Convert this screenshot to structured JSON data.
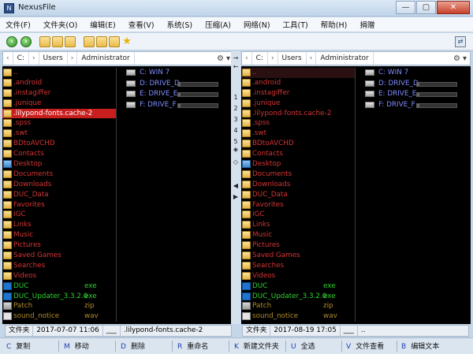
{
  "window": {
    "title": "NexusFile",
    "controls": [
      "—",
      "▢",
      "✕"
    ]
  },
  "menu": [
    "文件(F)",
    "文件夹(O)",
    "编辑(E)",
    "查看(V)",
    "系统(S)",
    "压缩(A)",
    "网络(N)",
    "工具(T)",
    "帮助(H)",
    "捐赠"
  ],
  "left": {
    "path": [
      "C:",
      "Users",
      "Administrator"
    ],
    "files": [
      {
        "name": "..",
        "type": "folder",
        "color": "#d43434",
        "ext": ""
      },
      {
        "name": ".android",
        "type": "folder",
        "color": "#d43434",
        "ext": ""
      },
      {
        "name": ".instagiffer",
        "type": "folder",
        "color": "#d43434",
        "ext": ""
      },
      {
        "name": ".junique",
        "type": "folder",
        "color": "#d43434",
        "ext": ""
      },
      {
        "name": ".lilypond-fonts.cache-2",
        "type": "folder",
        "color": "#ffffff",
        "ext": "",
        "selected": true
      },
      {
        "name": ".spss",
        "type": "folder",
        "color": "#d43434",
        "ext": ""
      },
      {
        "name": ".swt",
        "type": "folder",
        "color": "#d43434",
        "ext": ""
      },
      {
        "name": "BDtoAVCHD",
        "type": "folder",
        "color": "#d43434",
        "ext": ""
      },
      {
        "name": "Contacts",
        "type": "folder",
        "color": "#d43434",
        "ext": ""
      },
      {
        "name": "Desktop",
        "type": "folder-blue",
        "color": "#d43434",
        "ext": ""
      },
      {
        "name": "Documents",
        "type": "folder",
        "color": "#d43434",
        "ext": ""
      },
      {
        "name": "Downloads",
        "type": "folder",
        "color": "#d43434",
        "ext": ""
      },
      {
        "name": "DUC_Data",
        "type": "folder",
        "color": "#d43434",
        "ext": ""
      },
      {
        "name": "Favorites",
        "type": "folder",
        "color": "#d43434",
        "ext": ""
      },
      {
        "name": "IGC",
        "type": "folder",
        "color": "#d43434",
        "ext": ""
      },
      {
        "name": "Links",
        "type": "folder",
        "color": "#d43434",
        "ext": ""
      },
      {
        "name": "Music",
        "type": "folder",
        "color": "#d43434",
        "ext": ""
      },
      {
        "name": "Pictures",
        "type": "folder",
        "color": "#d43434",
        "ext": ""
      },
      {
        "name": "Saved Games",
        "type": "folder",
        "color": "#d43434",
        "ext": ""
      },
      {
        "name": "Searches",
        "type": "folder",
        "color": "#d43434",
        "ext": ""
      },
      {
        "name": "Videos",
        "type": "folder",
        "color": "#d43434",
        "ext": ""
      },
      {
        "name": "DUC",
        "type": "exe",
        "color": "#2fd12f",
        "ext": "exe"
      },
      {
        "name": "DUC_Updater_3.3.2.0",
        "type": "exe",
        "color": "#2fd12f",
        "ext": "exe"
      },
      {
        "name": "Patch",
        "type": "zip",
        "color": "#b08b2a",
        "ext": "zip"
      },
      {
        "name": "sound_notice",
        "type": "wav",
        "color": "#b08b2a",
        "ext": "wav"
      }
    ],
    "drives": [
      {
        "label": "C: WIN 7",
        "fill": 0
      },
      {
        "label": "D: DRIVE_D",
        "fill": 0.05
      },
      {
        "label": "E: DRIVE_E",
        "fill": 0.05
      },
      {
        "label": "F: DRIVE_F",
        "fill": 0.05
      }
    ],
    "status": [
      "文件夹",
      "2017-07-07 11:06",
      "___",
      ".lilypond-fonts.cache-2"
    ]
  },
  "right": {
    "path": [
      "C:",
      "Users",
      "Administrator"
    ],
    "files": [
      {
        "name": "..",
        "type": "folder",
        "color": "#d43434",
        "ext": "",
        "hilite": true
      },
      {
        "name": ".android",
        "type": "folder",
        "color": "#d43434",
        "ext": ""
      },
      {
        "name": ".instagiffer",
        "type": "folder",
        "color": "#d43434",
        "ext": ""
      },
      {
        "name": ".junique",
        "type": "folder",
        "color": "#d43434",
        "ext": ""
      },
      {
        "name": ".lilypond-fonts.cache-2",
        "type": "folder",
        "color": "#d43434",
        "ext": ""
      },
      {
        "name": ".spss",
        "type": "folder",
        "color": "#d43434",
        "ext": ""
      },
      {
        "name": ".swt",
        "type": "folder",
        "color": "#d43434",
        "ext": ""
      },
      {
        "name": "BDtoAVCHD",
        "type": "folder",
        "color": "#d43434",
        "ext": ""
      },
      {
        "name": "Contacts",
        "type": "folder",
        "color": "#d43434",
        "ext": ""
      },
      {
        "name": "Desktop",
        "type": "folder-blue",
        "color": "#d43434",
        "ext": ""
      },
      {
        "name": "Documents",
        "type": "folder",
        "color": "#d43434",
        "ext": ""
      },
      {
        "name": "Downloads",
        "type": "folder",
        "color": "#d43434",
        "ext": ""
      },
      {
        "name": "DUC_Data",
        "type": "folder",
        "color": "#d43434",
        "ext": ""
      },
      {
        "name": "Favorites",
        "type": "folder",
        "color": "#d43434",
        "ext": ""
      },
      {
        "name": "IGC",
        "type": "folder",
        "color": "#d43434",
        "ext": ""
      },
      {
        "name": "Links",
        "type": "folder",
        "color": "#d43434",
        "ext": ""
      },
      {
        "name": "Music",
        "type": "folder",
        "color": "#d43434",
        "ext": ""
      },
      {
        "name": "Pictures",
        "type": "folder",
        "color": "#d43434",
        "ext": ""
      },
      {
        "name": "Saved Games",
        "type": "folder",
        "color": "#d43434",
        "ext": ""
      },
      {
        "name": "Searches",
        "type": "folder",
        "color": "#d43434",
        "ext": ""
      },
      {
        "name": "Videos",
        "type": "folder",
        "color": "#d43434",
        "ext": ""
      },
      {
        "name": "DUC",
        "type": "exe",
        "color": "#2fd12f",
        "ext": "exe"
      },
      {
        "name": "DUC_Updater_3.3.2.0",
        "type": "exe",
        "color": "#2fd12f",
        "ext": "exe"
      },
      {
        "name": "Patch",
        "type": "zip",
        "color": "#b08b2a",
        "ext": "zip"
      },
      {
        "name": "sound_notice",
        "type": "wav",
        "color": "#b08b2a",
        "ext": "wav"
      }
    ],
    "drives": [
      {
        "label": "C: WIN 7",
        "fill": 0
      },
      {
        "label": "D: DRIVE_D",
        "fill": 0.05
      },
      {
        "label": "E: DRIVE_E",
        "fill": 0.05
      },
      {
        "label": "F: DRIVE_F",
        "fill": 0.05
      }
    ],
    "status": [
      "文件夹",
      "2017-08-19 17:05",
      "___",
      ".."
    ]
  },
  "middle": [
    "←",
    "→",
    "1",
    "2",
    "3",
    "4",
    "5",
    "◈",
    "◇",
    "◀",
    "▶"
  ],
  "fkeys": [
    {
      "key": "C",
      "label": "复制"
    },
    {
      "key": "M",
      "label": "移动"
    },
    {
      "key": "D",
      "label": "删除"
    },
    {
      "key": "R",
      "label": "重命名"
    },
    {
      "key": "K",
      "label": "新建文件夹"
    },
    {
      "key": "U",
      "label": "全选"
    },
    {
      "key": "V",
      "label": "文件查看"
    },
    {
      "key": "B",
      "label": "编辑文本"
    }
  ],
  "colors": {
    "folder_text": "#d43434",
    "exe_text": "#2fd12f",
    "archive_text": "#b08b2a",
    "drive_text": "#7f8cff",
    "selected_bg": "#c81e1e"
  }
}
